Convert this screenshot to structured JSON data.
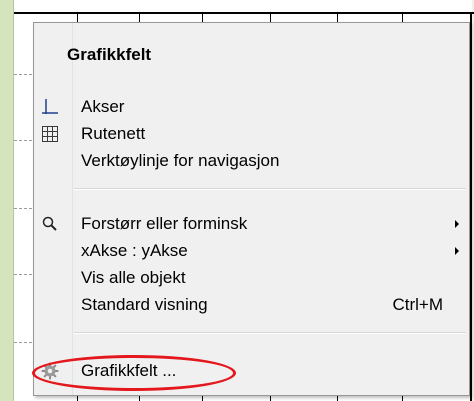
{
  "context_menu": {
    "title": "Grafikkfelt",
    "sections": [
      {
        "items": [
          {
            "label": "Akser",
            "icon": "axes-icon",
            "shortcut": "",
            "has_submenu": false
          },
          {
            "label": "Rutenett",
            "icon": "grid-icon",
            "shortcut": "",
            "has_submenu": false
          },
          {
            "label": "Verktøylinje for navigasjon",
            "icon": "",
            "shortcut": "",
            "has_submenu": false
          }
        ]
      },
      {
        "items": [
          {
            "label": "Forstørr eller forminsk",
            "icon": "magnifier-icon",
            "shortcut": "",
            "has_submenu": true
          },
          {
            "label": "xAkse : yAkse",
            "icon": "",
            "shortcut": "",
            "has_submenu": true
          },
          {
            "label": "Vis alle objekt",
            "icon": "",
            "shortcut": "",
            "has_submenu": false
          },
          {
            "label": "Standard visning",
            "icon": "",
            "shortcut": "Ctrl+M",
            "has_submenu": false
          }
        ]
      },
      {
        "items": [
          {
            "label": "Grafikkfelt ...",
            "icon": "gear-icon",
            "shortcut": "",
            "has_submenu": false,
            "highlighted": true
          }
        ]
      }
    ]
  },
  "colors": {
    "menu_background": "#f0f0f0",
    "left_strip": "#d6e4bd",
    "highlight_ring": "#e3171c",
    "grid_lines": "#9a9a9a"
  }
}
